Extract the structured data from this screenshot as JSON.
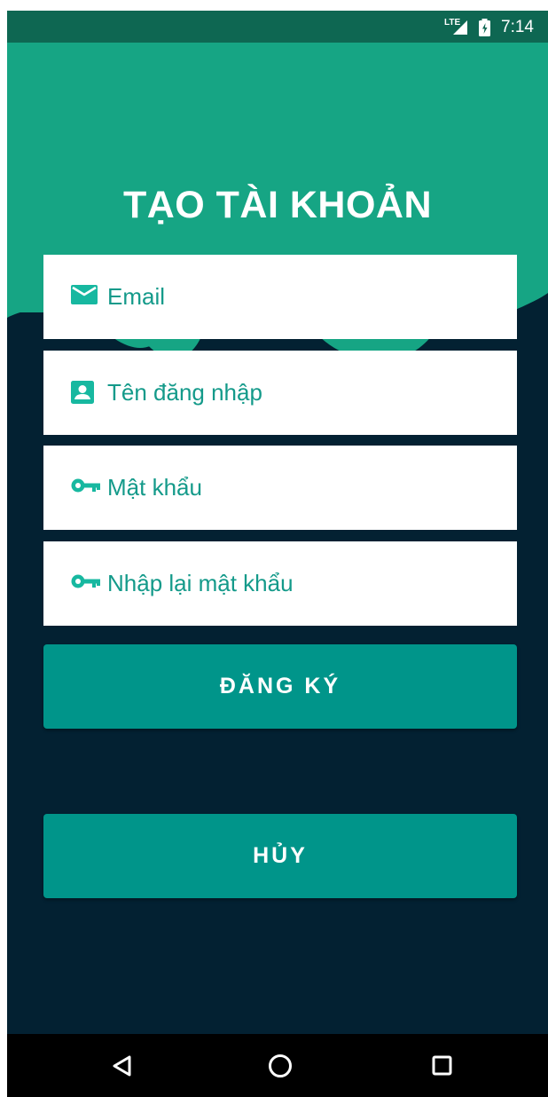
{
  "status_bar": {
    "network_label": "LTE",
    "time": "7:14",
    "icons": [
      "signal-icon",
      "battery-icon"
    ]
  },
  "colors": {
    "status_bar": "#0e6752",
    "header_green": "#16a584",
    "background_navy": "#032132",
    "button_teal": "#00958a",
    "field_text_teal": "#149a8a",
    "field_icon_teal": "#17b8a0"
  },
  "title": "TẠO TÀI KHOẢN",
  "form": {
    "email": {
      "placeholder": "Email",
      "value": "",
      "icon": "email-icon"
    },
    "username": {
      "placeholder": "Tên đăng nhập",
      "value": "",
      "icon": "account-box-icon"
    },
    "password": {
      "placeholder": "Mật khẩu",
      "value": "",
      "icon": "key-icon"
    },
    "confirm_password": {
      "placeholder": "Nhập lại mật khẩu",
      "value": "",
      "icon": "key-icon"
    }
  },
  "buttons": {
    "register": "ĐĂNG KÝ",
    "cancel": "HỦY"
  },
  "nav_bar": {
    "icons": [
      "back-icon",
      "home-icon",
      "recents-icon"
    ]
  }
}
